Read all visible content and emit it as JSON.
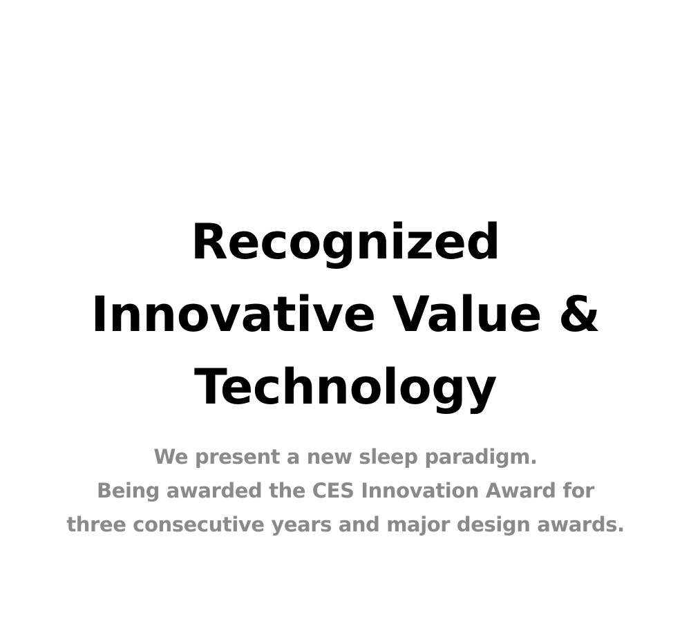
{
  "hero": {
    "title_lines": [
      "Recognized",
      "Innovative Value &",
      "Technology"
    ],
    "subtitle_lines": [
      "We present a new sleep paradigm.",
      "Being awarded the CES Innovation Award for",
      "three consecutive years and major design awards."
    ]
  },
  "colors": {
    "background": "#ffffff",
    "title": "#000000",
    "subtitle": "#8a8a8a"
  }
}
